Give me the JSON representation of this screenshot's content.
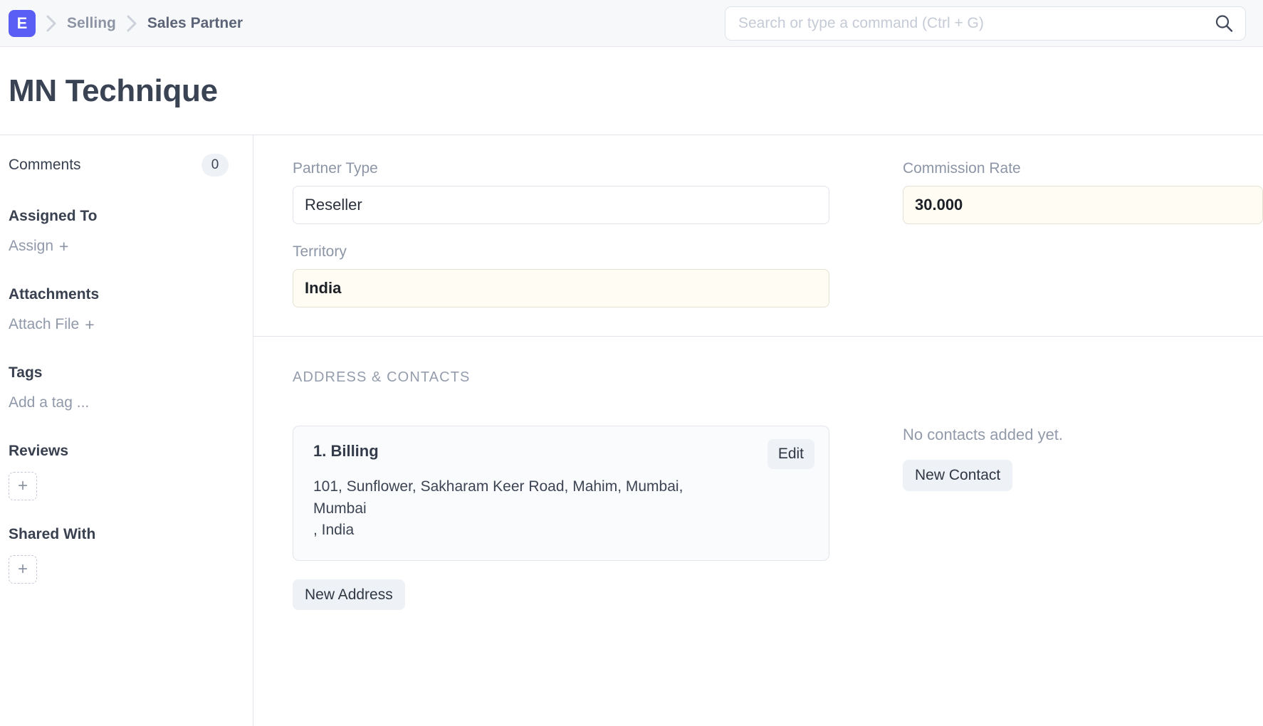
{
  "navbar": {
    "logo_letter": "E",
    "logo_color": "#5b5ef4",
    "breadcrumbs": [
      {
        "label": "Selling",
        "active": false
      },
      {
        "label": "Sales Partner",
        "active": true
      }
    ],
    "search": {
      "placeholder": "Search or type a command (Ctrl + G)",
      "value": "",
      "icon": "search-icon"
    }
  },
  "header": {
    "title": "MN Technique"
  },
  "sidebar": {
    "comments": {
      "label": "Comments",
      "count": "0"
    },
    "assigned_to": {
      "label": "Assigned To",
      "action": "Assign",
      "action_icon": "plus-icon"
    },
    "attachments": {
      "label": "Attachments",
      "action": "Attach File",
      "action_icon": "plus-icon"
    },
    "tags": {
      "label": "Tags",
      "placeholder": "Add a tag ..."
    },
    "reviews": {
      "label": "Reviews",
      "add_icon": "plus-icon"
    },
    "shared_with": {
      "label": "Shared With",
      "add_icon": "plus-icon"
    }
  },
  "form": {
    "partner_type": {
      "label": "Partner Type",
      "value": "Reseller",
      "highlighted": false
    },
    "territory": {
      "label": "Territory",
      "value": "India",
      "highlighted": true
    },
    "commission_rate": {
      "label": "Commission Rate",
      "value": "30.000",
      "highlighted": true
    }
  },
  "address_contacts": {
    "section_title": "ADDRESS & CONTACTS",
    "address_card": {
      "title": "1. Billing",
      "line1": "101, Sunflower, Sakharam Keer Road, Mahim, Mumbai,",
      "line2": "Mumbai",
      "line3": ", India",
      "edit_label": "Edit"
    },
    "new_address_label": "New Address",
    "contacts_empty_text": "No contacts added yet.",
    "new_contact_label": "New Contact"
  }
}
